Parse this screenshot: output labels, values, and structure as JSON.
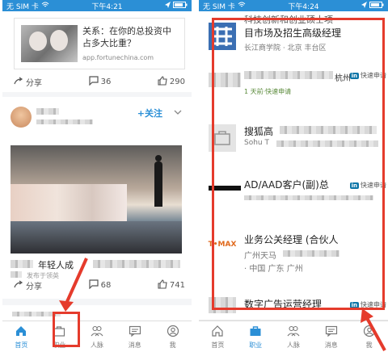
{
  "left": {
    "status": {
      "carrier": "无 SIM 卡",
      "time": "下午4:21"
    },
    "link_card": {
      "title": "关系：在你的总投资中占多大比重？",
      "url": "app.fortunechina.com"
    },
    "top_actions": {
      "share": "分享",
      "comments": "36",
      "likes": "290"
    },
    "post": {
      "follow": "+关注",
      "caption": "年轻人成",
      "caption_sub": "发布于领英"
    },
    "bottom_actions": {
      "share": "分享",
      "comments": "68",
      "likes": "741"
    },
    "tabs": [
      {
        "label": "首页"
      },
      {
        "label": "职业"
      },
      {
        "label": "人脉"
      },
      {
        "label": "消息"
      },
      {
        "label": "我"
      }
    ]
  },
  "right": {
    "status": {
      "carrier": "无 SIM 卡",
      "time": "下午4:24"
    },
    "jobs": [
      {
        "title_partial": "科技创新和创业硕士项",
        "title": "目市场及招生高级经理",
        "company": "长江商学院 · 北京 丰台区"
      },
      {
        "title": "",
        "company": "杭州",
        "extra": "1 天前·快速申请",
        "apply": "快速申请"
      },
      {
        "title": "搜狐高",
        "company": "Sohu T"
      },
      {
        "title": "AD/AAD客户(副)总",
        "apply": "快速申请"
      },
      {
        "title": "业务公关经理 (合伙人",
        "company": "广州天马",
        "location": "· 中国 广东 广州",
        "logo_text": "T•MAX"
      },
      {
        "title": "数字广告运营经理",
        "apply": "快速申请"
      }
    ],
    "tabs": [
      {
        "label": "首页"
      },
      {
        "label": "职业"
      },
      {
        "label": "人脉"
      },
      {
        "label": "消息"
      },
      {
        "label": "我"
      }
    ]
  },
  "colors": {
    "brand": "#2b8fd6",
    "highlight": "#e53b2c",
    "linkedin": "#0e76a8"
  }
}
